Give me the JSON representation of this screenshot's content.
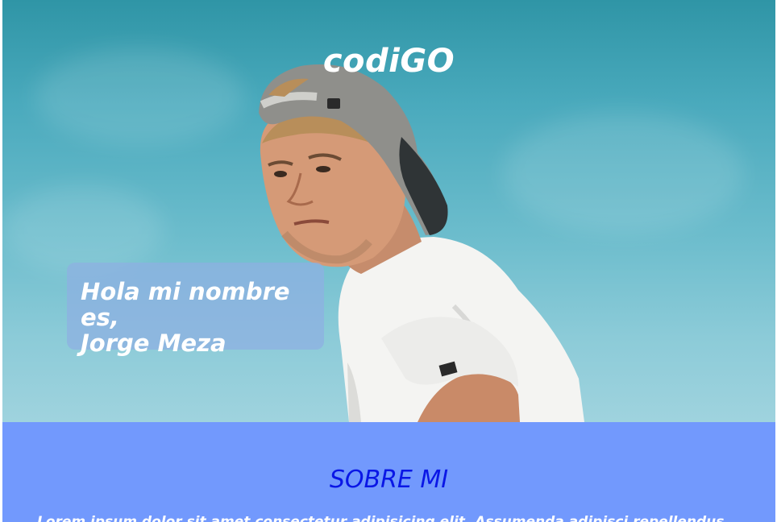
{
  "header": {
    "brand": "codiGO"
  },
  "hero": {
    "greeting_line1": "Hola mi nombre es,",
    "greeting_line2": "Jorge Meza",
    "photo": "man-with-backwards-cap-photo"
  },
  "about": {
    "title": "SOBRE MI",
    "text": "Lorem ipsum dolor sit amet consectetur adipisicing elit. Assumenda adipisci repellendus"
  },
  "colors": {
    "sky_top": "#2f95a6",
    "sky_bottom": "#9fd3de",
    "intro_box": "#8eb0e2",
    "about_bg": "#7299fd",
    "about_title": "#0a17e6"
  }
}
